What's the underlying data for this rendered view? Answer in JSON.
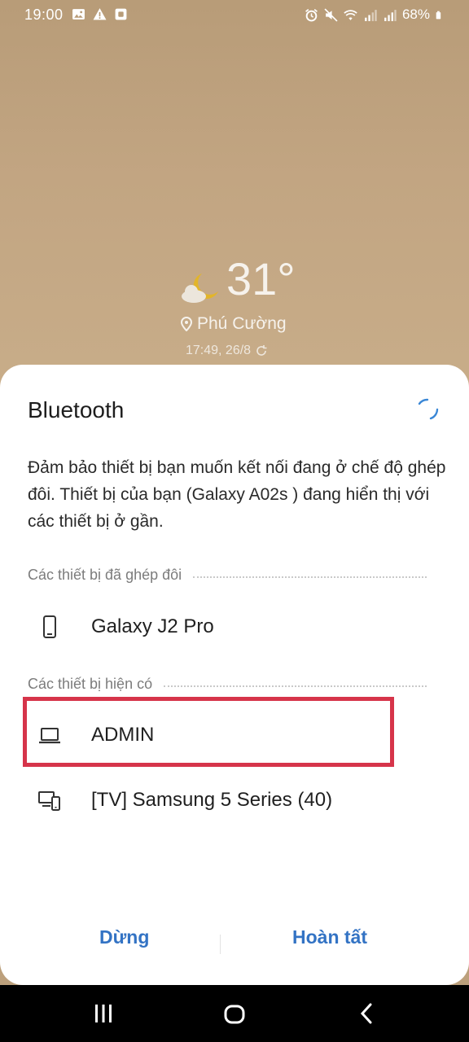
{
  "status_bar": {
    "time": "19:00",
    "battery": "68%",
    "icons_left": [
      "gallery-icon",
      "warning-icon",
      "screenshot-icon"
    ],
    "icons_right": [
      "alarm-icon",
      "mute-icon",
      "wifi-icon",
      "signal-icon",
      "signal-icon",
      "battery-icon"
    ]
  },
  "weather": {
    "temperature": "31°",
    "location": "Phú Cường",
    "updated": "17:49, 26/8",
    "icon": "partly-cloudy-night-icon"
  },
  "dialog": {
    "title": "Bluetooth",
    "description": "Đảm bảo thiết bị bạn muốn kết nối đang ở chế độ ghép đôi. Thiết bị của bạn (Galaxy A02s ) đang hiển thị với các thiết bị ở gần.",
    "paired_header": "Các thiết bị đã ghép đôi",
    "paired_devices": [
      {
        "name": "Galaxy J2 Pro",
        "icon": "phone-icon"
      }
    ],
    "available_header": "Các thiết bị hiện có",
    "available_devices": [
      {
        "name": "ADMIN",
        "icon": "laptop-icon"
      },
      {
        "name": "[TV] Samsung 5 Series (40)",
        "icon": "multi-device-icon"
      }
    ],
    "stop_label": "Dừng",
    "done_label": "Hoàn tất",
    "accent_color": "#3373c4",
    "highlight_color": "#d6344a"
  },
  "nav_bar": {
    "buttons": [
      "recents-icon",
      "home-icon",
      "back-icon"
    ]
  }
}
